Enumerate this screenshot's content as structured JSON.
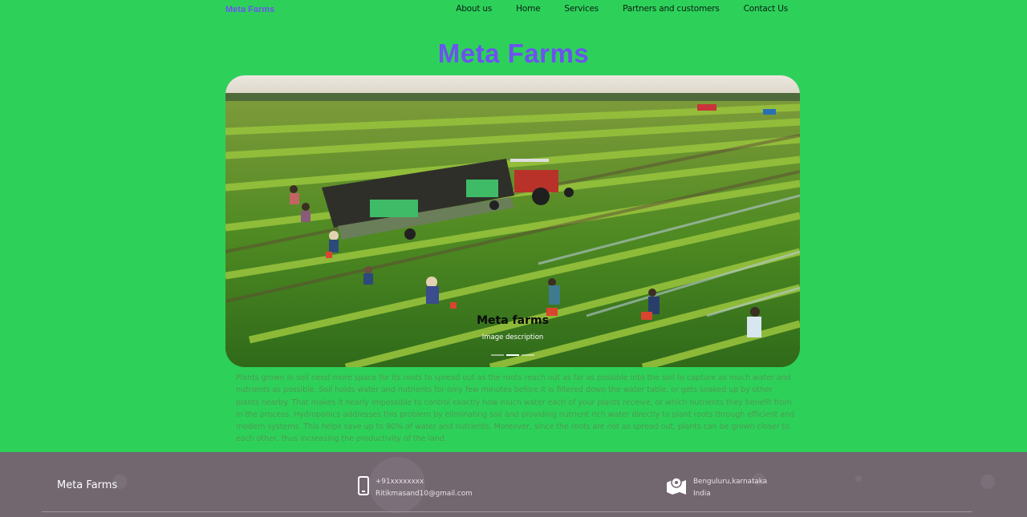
{
  "nav": {
    "brand": "Meta Farms",
    "links": [
      "About us",
      "Home",
      "Services",
      "Partners and customers",
      "Contact Us"
    ]
  },
  "hero": {
    "title": "Meta Farms"
  },
  "carousel": {
    "caption_title": "Meta farms",
    "caption_description": "Image description",
    "indicator_count": 3,
    "active_index": 1
  },
  "content": {
    "paragraph": "Plants grown in soil need more space for its roots to spread out as the roots reach out as far as possible into the soil to capture as much water and nutrients as possible. Soil holds water and nutrients for only few minutes before it is filtered down the water table, or gets soaked up by other plants nearby. That makes it nearly impossible to control exactly how much water each of your plants receive, or which nutrients they benefit from in the process. Hydroponics addresses this problem by eliminating soil and providing nutrient rich water directly to plant roots through efficient and modern systems. This helps save up to 90% of water and nutrients. Moreover, since the roots are not as spread out, plants can be grown closer to each other, thus increasing the productivity of the land."
  },
  "footer": {
    "brand": "Meta Farms",
    "phone": "+91xxxxxxxx",
    "email": "Ritikmasand10@gmail.com",
    "city": "Benguluru,karnataka",
    "country": "India",
    "phone_icon": "phone-icon",
    "location_icon": "map-location-icon"
  },
  "colors": {
    "page_background": "#2dd15a",
    "brand_purple": "#6c52f0",
    "footer_background": "#72666f"
  }
}
